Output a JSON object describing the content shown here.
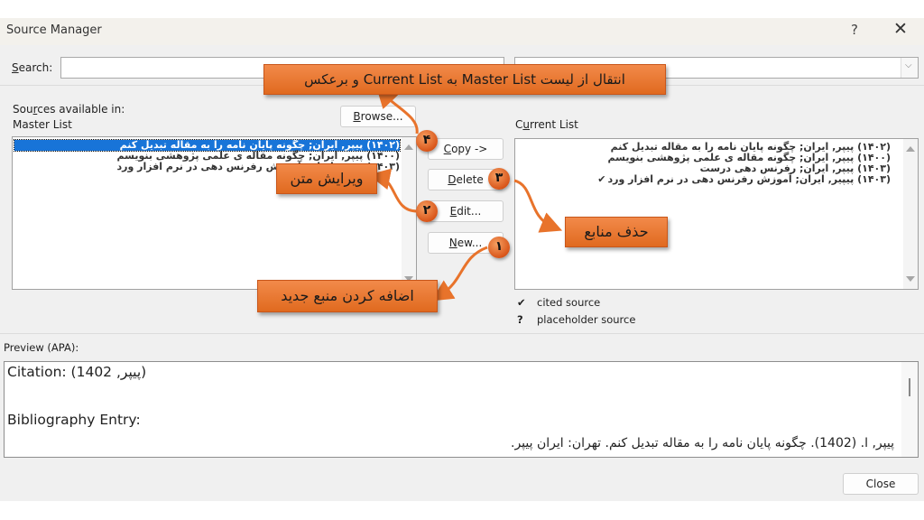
{
  "window": {
    "title": "Source Manager",
    "help_label": "?",
    "close_label": "✕"
  },
  "search": {
    "label_prefix": "",
    "label_accel": "S",
    "label_rest": "earch:",
    "value": "",
    "placeholder": "",
    "sort_value": ""
  },
  "master": {
    "header_line1_pre": "Sou",
    "header_line1_accel": "r",
    "header_line1_post": "ces available in:",
    "header_line2": "Master List",
    "browse_accel": "B",
    "browse_rest": "rowse...",
    "items": [
      {
        "text": "(۱۴۰۲) پیپر, ایران; چگونه پایان نامه را به مقاله تبدیل کنم",
        "selected": true
      },
      {
        "text": "(۱۴۰۰) پیپر, ایران; چگونه مقاله ی علمی پژوهشی بنویسم",
        "selected": false
      },
      {
        "text": "(۱۴۰۳) پیپیر, ایران; آموزش رفرنس دهی در نرم افزار ورد",
        "selected": false
      }
    ]
  },
  "buttons": {
    "copy": {
      "accel": "C",
      "rest": "opy ->"
    },
    "delete": {
      "accel": "D",
      "rest": "elete"
    },
    "edit": {
      "accel": "E",
      "rest": "dit..."
    },
    "new": {
      "accel": "N",
      "rest": "ew..."
    },
    "close": "Close"
  },
  "current": {
    "header_pre": "C",
    "header_accel": "u",
    "header_post": "rrent List",
    "items": [
      {
        "text": "(۱۴۰۲) پیپر, ایران; چگونه پایان نامه را به مقاله تبدیل کنم",
        "mark": ""
      },
      {
        "text": "(۱۴۰۰) پیپر, ایران; چگونه مقاله ی علمی پژوهشی بنویسم",
        "mark": ""
      },
      {
        "text": "(۱۴۰۳) پیپر, ایران; رفرنس دهی درست",
        "mark": ""
      },
      {
        "text": "(۱۴۰۳) پیپیر, ایران; آموزش رفرنس دهی در نرم افزار ورد",
        "mark": "✔"
      }
    ]
  },
  "legend": [
    {
      "symbol": "✔",
      "label": "cited source"
    },
    {
      "symbol": "?",
      "label": "placeholder source"
    }
  ],
  "preview": {
    "label": "Preview (APA):",
    "citation": "Citation:  (1402 ,پیپر)",
    "bibliography_label": "Bibliography Entry:",
    "bibliography": "پیپر, ا. (1402). چگونه پایان نامه را به مقاله تبدیل کنم. تهران: ایران پیپر."
  },
  "annotations": {
    "transfer": "انتقال از لیست  Master List به  Current List و برعکس",
    "edit_text": "ویرایش متن",
    "delete_sources": "حذف منابع",
    "add_new": "اضافه کردن منبع جدید",
    "badge_1": "۱",
    "badge_2": "۲",
    "badge_3": "۳",
    "badge_4": "۴",
    "accent_color": "#e8732b"
  }
}
